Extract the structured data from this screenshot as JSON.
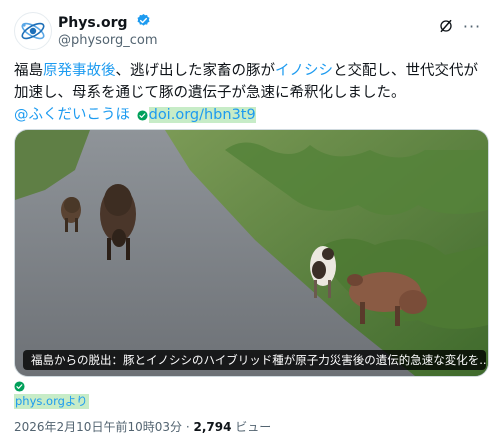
{
  "account": {
    "display_name": "Phys.org",
    "handle": "@physorg_com"
  },
  "tweet": {
    "text_1": "福島",
    "text_link_1": "原発事故後",
    "text_2": "、逃げ出した家畜の豚が",
    "text_link_2": "イノシシ",
    "text_3": "と交配し、世代交代が加速し、母系を通じて豚の遺伝子が急速に希釈化しました。",
    "mention": "@ふくだいこうほ",
    "url": "doi.org/hbn3t9"
  },
  "media": {
    "caption": "福島からの脱出：豚とイノシシのハイブリッド種が原子力災害後の遺伝的急速な変化を..."
  },
  "source": {
    "label": "phys.orgより"
  },
  "meta": {
    "timestamp": "2026年2月10日午前10時03分",
    "separator": "·",
    "views_count": "2,794",
    "views_label": "ビュー"
  },
  "icons": {
    "avatar": "phys-org-logo-icon",
    "verified": "verified-badge-icon",
    "grok": "grok-icon",
    "more": "more-icon"
  },
  "colors": {
    "link": "#1d9bf0",
    "highlight": "#c7ecc7",
    "verified": "#1d9bf0",
    "muted": "#536471"
  }
}
